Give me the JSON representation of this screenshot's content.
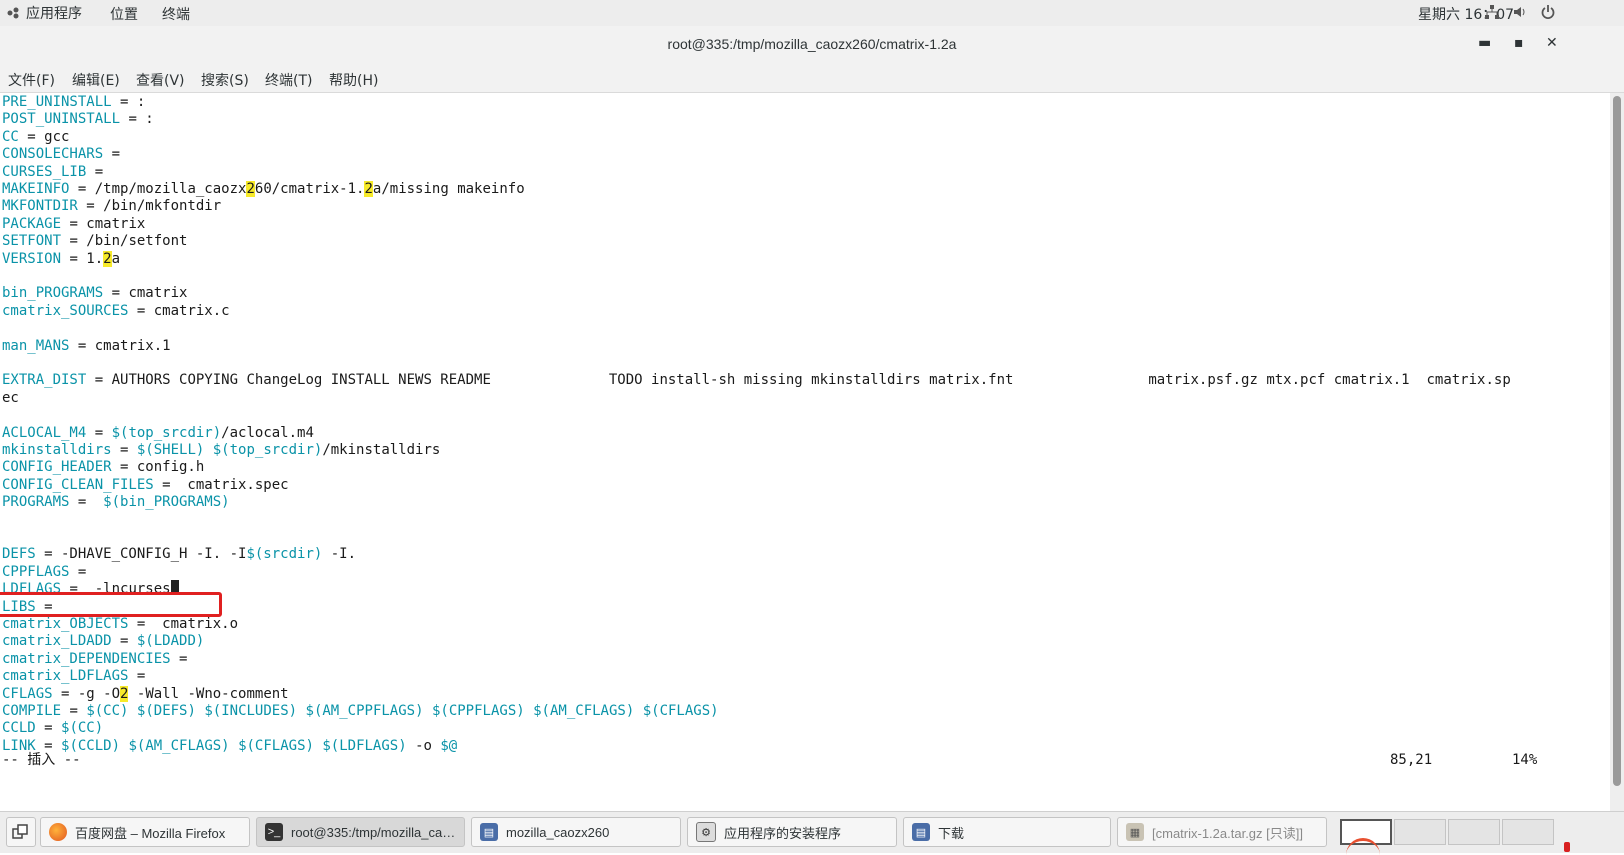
{
  "top_panel": {
    "applications": "应用程序",
    "places": "位置",
    "terminal": "终端",
    "clock": "星期六 16：07"
  },
  "window": {
    "title": "root@335:/tmp/mozilla_caozx260/cmatrix-1.2a",
    "minimize": "▬",
    "maximize": "▪",
    "close": "✕"
  },
  "menubar": [
    "文件(F)",
    "编辑(E)",
    "查看(V)",
    "搜索(S)",
    "终端(T)",
    "帮助(H)"
  ],
  "terminal": {
    "lines": [
      {
        "k": "PRE_UNINSTALL",
        "r": " = :"
      },
      {
        "k": "POST_UNINSTALL",
        "r": " = :"
      },
      {
        "k": "CC",
        "r": " = gcc"
      },
      {
        "k": "CONSOLECHARS",
        "r": " ="
      },
      {
        "k": "CURSES_LIB",
        "r": " ="
      },
      {
        "k": "MAKEINFO",
        "r": " = /tmp/mozilla_caozx260/cmatrix-1.2a/missing makeinfo"
      },
      {
        "k": "MKFONTDIR",
        "r": " = /bin/mkfontdir"
      },
      {
        "k": "PACKAGE",
        "r": " = cmatrix"
      },
      {
        "k": "SETFONT",
        "r": " = /bin/setfont"
      },
      {
        "k": "VERSION",
        "r": " = 1.2a"
      },
      {
        "k": "",
        "r": ""
      },
      {
        "k": "bin_PROGRAMS",
        "r": " = cmatrix"
      },
      {
        "k": "cmatrix_SOURCES",
        "r": " = cmatrix.c"
      },
      {
        "k": "",
        "r": ""
      },
      {
        "k": "man_MANS",
        "r": " = cmatrix.1"
      },
      {
        "k": "",
        "r": ""
      },
      {
        "k": "EXTRA_DIST",
        "r": " = AUTHORS COPYING ChangeLog INSTALL NEWS README              TODO install-sh missing mkinstalldirs matrix.fnt                matrix.psf.gz mtx.pcf cmatrix.1  cmatrix.sp"
      },
      {
        "k": "",
        "r": "ec"
      },
      {
        "k": "",
        "r": ""
      },
      {
        "k": "ACLOCAL_M4",
        "r": " = $(top_srcdir)/aclocal.m4"
      },
      {
        "k": "mkinstalldirs",
        "r": " = $(SHELL) $(top_srcdir)/mkinstalldirs"
      },
      {
        "k": "CONFIG_HEADER",
        "r": " = config.h"
      },
      {
        "k": "CONFIG_CLEAN_FILES",
        "r": " =  cmatrix.spec"
      },
      {
        "k": "PROGRAMS",
        "r": " =  $(bin_PROGRAMS)"
      },
      {
        "k": "",
        "r": ""
      },
      {
        "k": "",
        "r": ""
      },
      {
        "k": "DEFS",
        "r": " = -DHAVE_CONFIG_H -I. -I$(srcdir) -I."
      },
      {
        "k": "CPPFLAGS",
        "r": " ="
      },
      {
        "k": "LDFLAGS",
        "r": " =  -lncurses"
      },
      {
        "k": "LIBS",
        "r": " ="
      },
      {
        "k": "cmatrix_OBJECTS",
        "r": " =  cmatrix.o"
      },
      {
        "k": "cmatrix_LDADD",
        "r": " = $(LDADD)"
      },
      {
        "k": "cmatrix_DEPENDENCIES",
        "r": " ="
      },
      {
        "k": "cmatrix_LDFLAGS",
        "r": " ="
      },
      {
        "k": "CFLAGS",
        "r": " = -g -O2 -Wall -Wno-comment"
      },
      {
        "k": "COMPILE",
        "r": " = $(CC) $(DEFS) $(INCLUDES) $(AM_CPPFLAGS) $(CPPFLAGS) $(AM_CFLAGS) $(CFLAGS)"
      },
      {
        "k": "CCLD",
        "r": " = $(CC)"
      },
      {
        "k": "LINK",
        "r": " = $(CCLD) $(AM_CFLAGS) $(CFLAGS) $(LDFLAGS) -o $@"
      }
    ],
    "status_mode": "-- 插入 --",
    "status_position": "85,21",
    "status_percent": "14%"
  },
  "taskbar": {
    "items": [
      {
        "label": "百度网盘 – Mozilla Firefox",
        "icon": "firefox-icon"
      },
      {
        "label": "root@335:/tmp/mozilla_ca…",
        "icon": "terminal-icon"
      },
      {
        "label": "mozilla_caozx260",
        "icon": "folder-icon"
      },
      {
        "label": "应用程序的安装程序",
        "icon": "installer-icon"
      },
      {
        "label": "下载",
        "icon": "folder-icon"
      },
      {
        "label": "[cmatrix-1.2a.tar.gz [只读]]",
        "icon": "archive-icon"
      }
    ]
  }
}
